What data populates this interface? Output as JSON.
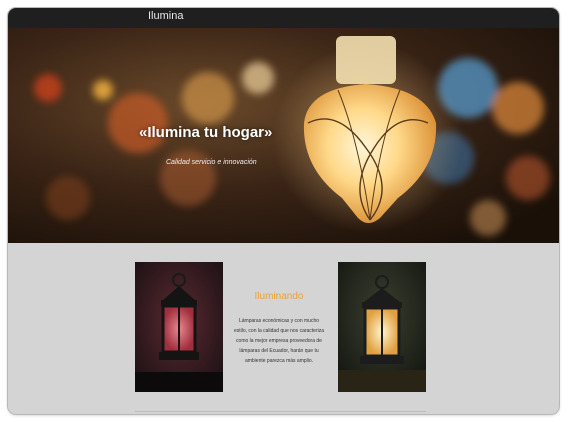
{
  "site": {
    "brand": "Ilumina"
  },
  "hero": {
    "title": "«Ilumina tu hogar»",
    "subtitle": "Calidad servicio e innovación"
  },
  "section": {
    "title": "Iluminando",
    "text": "Lámparas económicas y con mucho estilo, con la calidad que nos caracteriza como la mejor empresa proveedora de lámparas del Ecuador, harán que tu ambiente parezca más amplio."
  },
  "images": {
    "hero": "glowing-lantern-bokeh-photo",
    "left": "dark-lantern-photo",
    "right": "lit-lantern-photo"
  },
  "colors": {
    "accent": "#e8a23a",
    "topbar": "#1f1f1f",
    "content_bg": "#d4d4d4"
  }
}
